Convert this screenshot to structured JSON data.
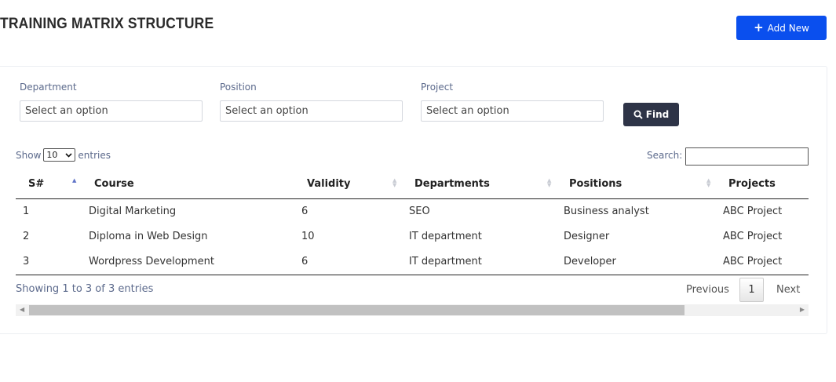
{
  "header": {
    "title": "TRAINING MATRIX STRUCTURE",
    "add_label": "Add New"
  },
  "filters": {
    "department": {
      "label": "Department",
      "value": "Select an option"
    },
    "position": {
      "label": "Position",
      "value": "Select an option"
    },
    "project": {
      "label": "Project",
      "value": "Select an option"
    },
    "find_label": "Find"
  },
  "table_controls": {
    "show": "Show",
    "length": "10",
    "entries": "entries",
    "search_label": "Search:"
  },
  "table": {
    "columns": [
      "S#",
      "Course",
      "Validity",
      "Departments",
      "Positions",
      "Projects"
    ],
    "rows": [
      [
        "1",
        "Digital Marketing",
        "6",
        "SEO",
        "Business analyst",
        "ABC Project"
      ],
      [
        "2",
        "Diploma in Web Design",
        "10",
        "IT department",
        "Designer",
        "ABC Project"
      ],
      [
        "3",
        "Wordpress Development",
        "6",
        "IT department",
        "Developer",
        "ABC Project"
      ]
    ]
  },
  "footer": {
    "info": "Showing 1 to 3 of 3 entries",
    "previous": "Previous",
    "page": "1",
    "next": "Next"
  },
  "colors": {
    "primary": "#0a4fee",
    "find_button": "#2e3447",
    "label": "#5c6a8c"
  }
}
